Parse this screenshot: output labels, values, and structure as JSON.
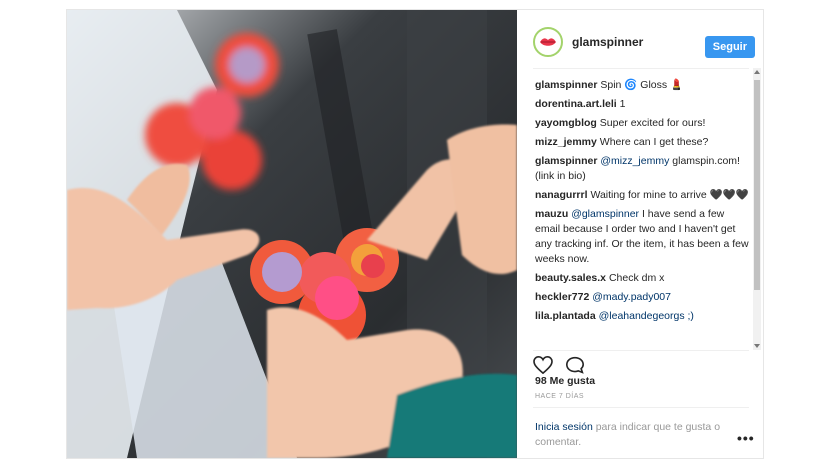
{
  "post": {
    "photo_alt": "",
    "author": {
      "username": "glamspinner",
      "follow_label": "Seguir"
    },
    "caption": {
      "username": "glamspinner",
      "text": "Spin 🌀 Gloss 💄"
    },
    "comments": [
      {
        "user": "dorentina.art.leli",
        "parts": [
          {
            "t": "1"
          }
        ]
      },
      {
        "user": "yayomgblog",
        "parts": [
          {
            "t": "Super excited for ours!"
          }
        ]
      },
      {
        "user": "mizz_jemmy",
        "parts": [
          {
            "t": "Where can I get these?"
          }
        ]
      },
      {
        "user": "glamspinner",
        "parts": [
          {
            "t": "@mizz_jemmy",
            "m": true
          },
          {
            "t": " glamspin.com! (link in bio)"
          }
        ]
      },
      {
        "user": "nanagurrrl",
        "parts": [
          {
            "t": "Waiting for mine to arrive 🖤🖤🖤"
          }
        ]
      },
      {
        "user": "mauzu",
        "parts": [
          {
            "t": "@glamspinner",
            "m": true
          },
          {
            "t": " I have send a few email because I order two and I haven't get any tracking inf. Or the item, it has been a few weeks now."
          }
        ]
      },
      {
        "user": "beauty.sales.x",
        "parts": [
          {
            "t": "Check dm x"
          }
        ]
      },
      {
        "user": "heckler772",
        "parts": [
          {
            "t": "@mady.pady007",
            "m": true
          }
        ]
      },
      {
        "user": "lila.plantada",
        "parts": [
          {
            "t": "@leahandegeorgs ;)",
            "m": true
          }
        ]
      }
    ],
    "likes": "98 Me gusta",
    "time": "HACE 7 DÍAS",
    "login_link": "Inicia sesión",
    "login_text": " para indicar que te gusta o comentar.",
    "more_label": "•••",
    "icons": {
      "like": "heart-icon",
      "comment": "comment-bubble-icon",
      "more": "more-options-icon"
    },
    "colors": {
      "accent": "#3897f0",
      "mention": "#003569",
      "avatar_ring": "#a3d36b"
    }
  }
}
